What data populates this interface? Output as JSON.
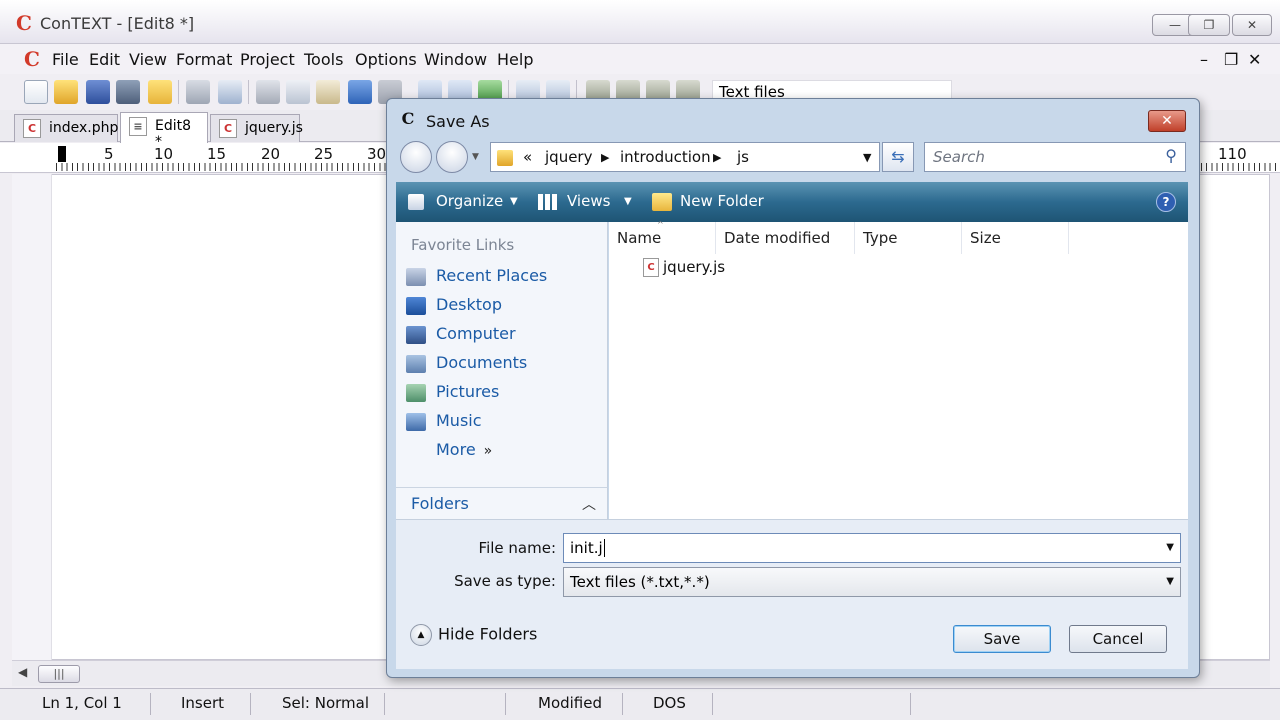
{
  "app": {
    "title": "ConTEXT - [Edit8 *]",
    "logo_letter": "C",
    "window_buttons": [
      "—",
      "❐",
      "✕"
    ]
  },
  "menu": [
    "File",
    "Edit",
    "View",
    "Format",
    "Project",
    "Tools",
    "Options",
    "Window",
    "Help"
  ],
  "menu_window_controls": [
    "–",
    "❐",
    "✕"
  ],
  "toolbar": {
    "filter_value": "Text files"
  },
  "tabs": [
    {
      "label": "index.php",
      "active": false
    },
    {
      "label": "Edit8 *",
      "active": true
    },
    {
      "label": "jquery.js",
      "active": false
    }
  ],
  "ruler": {
    "numbers": [
      "5",
      "10",
      "15",
      "20",
      "25",
      "30"
    ],
    "right_number": "110"
  },
  "statusbar": {
    "position": "Ln 1, Col 1",
    "mode": "Insert",
    "selection": "Sel: Normal",
    "modified": "Modified",
    "format": "DOS"
  },
  "dialog": {
    "title": "Save As",
    "breadcrumb": [
      "jquery",
      "introduction",
      "js"
    ],
    "breadcrumb_prefix": "«",
    "search_placeholder": "Search",
    "commands": {
      "organize": "Organize",
      "views": "Views",
      "new_folder": "New Folder"
    },
    "favorites_header": "Favorite Links",
    "favorites": [
      "Recent Places",
      "Desktop",
      "Computer",
      "Documents",
      "Pictures",
      "Music",
      "More"
    ],
    "folders_label": "Folders",
    "columns": [
      "Name",
      "Date modified",
      "Type",
      "Size"
    ],
    "files": [
      "jquery.js"
    ],
    "file_name_label": "File name:",
    "file_name_value": "init.j",
    "save_type_label": "Save as type:",
    "save_type_value": "Text files (*.txt,*.*)",
    "hide_folders": "Hide Folders",
    "save_button": "Save",
    "cancel_button": "Cancel"
  },
  "colors": {
    "accent_red": "#d23a2a",
    "command_bar": "#2c6a8f",
    "link_blue": "#1b5ba6"
  }
}
